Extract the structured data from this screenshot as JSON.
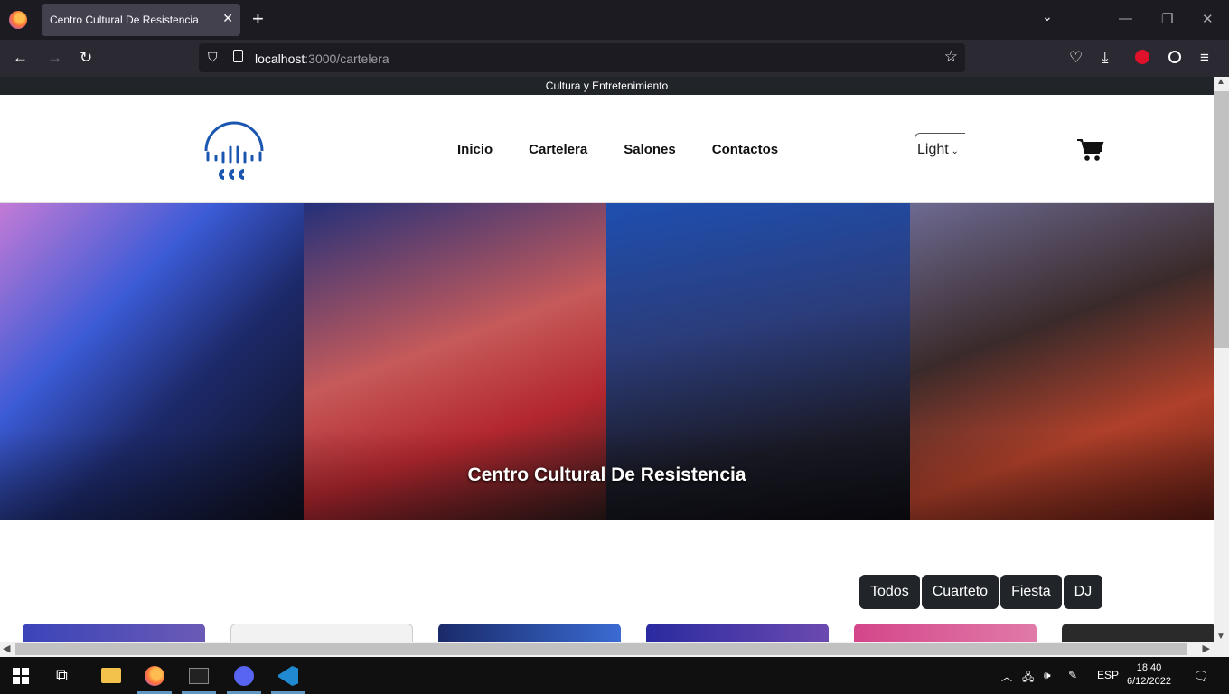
{
  "browser": {
    "tab_title": "Centro Cultural De Resistencia",
    "url_host": "localhost",
    "url_path": ":3000/cartelera",
    "icons": [
      "firefox-icon",
      "close-icon",
      "plus-icon",
      "chevron-down-icon",
      "back-icon",
      "forward-icon",
      "reload-icon",
      "shield-icon",
      "page-icon",
      "star-icon",
      "pocket-icon",
      "download-icon",
      "extension-icon",
      "account-icon",
      "menu-icon"
    ]
  },
  "site": {
    "topbar_text": "Cultura y Entretenimiento",
    "nav": [
      "Inicio",
      "Cartelera",
      "Salones",
      "Contactos"
    ],
    "theme_value": "Light",
    "hero_title": "Centro Cultural De Resistencia",
    "filters": [
      "Todos",
      "Cuarteto",
      "Fiesta",
      "DJ"
    ],
    "colors": {
      "dark": "#212529",
      "logo_blue": "#1a56b0"
    }
  },
  "taskbar": {
    "language": "ESP",
    "time": "18:40",
    "date": "6/12/2022"
  }
}
